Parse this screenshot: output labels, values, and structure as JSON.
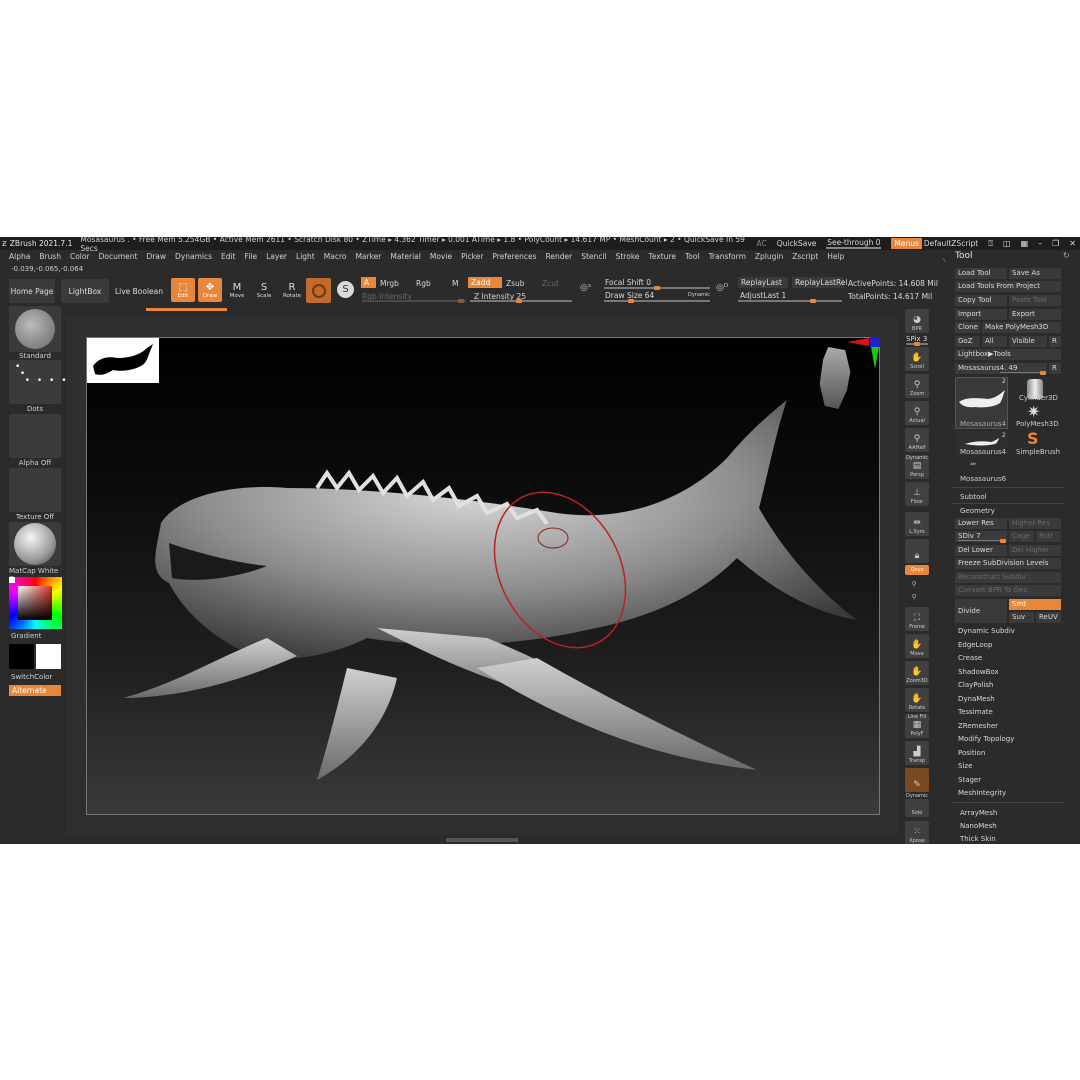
{
  "titlebar": {
    "app": "ZBrush 2021.7.1",
    "status": "Mosasaurus  . • Free Mem 5.254GB • Active Mem 2611 • Scratch Disk 80 •  ZTime ▸ 4.362 Timer ▸ 0.001 ATime ▸ 1.8 • PolyCount ▸ 14.617 MP  • MeshCount ▸ 2  • QuickSave In 59 Secs",
    "ac": "AC",
    "quicksave": "QuickSave",
    "seethrough": "See-through  0",
    "menus": "Menus",
    "script": "DefaultZScript"
  },
  "menubar": [
    "Alpha",
    "Brush",
    "Color",
    "Document",
    "Draw",
    "Dynamics",
    "Edit",
    "File",
    "Layer",
    "Light",
    "Macro",
    "Marker",
    "Material",
    "Movie",
    "Picker",
    "Preferences",
    "Render",
    "Stencil",
    "Stroke",
    "Texture",
    "Tool",
    "Transform",
    "Zplugin",
    "Zscript",
    "Help"
  ],
  "coords": "-0.039,-0.065,-0.064",
  "shelf": {
    "home": "Home Page",
    "lightbox": "LightBox",
    "liveboolean": "Live Boolean",
    "edit": "Edit",
    "draw": "Draw",
    "move": "Move",
    "scale": "Scale",
    "rotate": "Rotate",
    "a": "A",
    "mrgb": "Mrgb",
    "rgb": "Rgb",
    "m": "M",
    "rgbintensity": "Rgb Intensity",
    "zadd": "Zadd",
    "zsub": "Zsub",
    "zcut": "Zcut",
    "zintensity": "Z Intensity 25",
    "focalshift": "Focal Shift 0",
    "drawsize": "Draw Size 64",
    "dynamic": "Dynamic",
    "replaylast": "ReplayLast",
    "replaylastrel": "ReplayLastRel",
    "adjustlast": "AdjustLast 1",
    "activepoints": "ActivePoints: 14.608 Mil",
    "totalpoints": "TotalPoints: 14.617 Mil"
  },
  "lefttray": {
    "standard": "Standard",
    "dots": "Dots",
    "alpha": "Alpha Off",
    "texture": "Texture Off",
    "matcap": "MatCap White C",
    "gradient": "Gradient",
    "switchcolor": "SwitchColor",
    "alternate": "Alternate"
  },
  "righttray": {
    "bpr": "BPR",
    "spix": "SPix 3",
    "scroll": "Scroll",
    "zoom": "Zoom",
    "actual": "Actual",
    "aahalf": "AAHalf",
    "dynamic": "Dynamic",
    "persp": "Persp",
    "floor": "Floor",
    "lsym": "L.Sym",
    "xyz": "Qxyz",
    "frame": "Frame",
    "move": "Move",
    "zoom3d": "Zoom3D",
    "rotate": "Rotate",
    "linefill": "Line Fill",
    "polyf": "PolyF",
    "transp": "Transp",
    "dynamic2": "Dynamic",
    "solo": "Solo",
    "xpose": "Xpose"
  },
  "tool": {
    "title": "Tool",
    "loadtool": "Load Tool",
    "saveas": "Save As",
    "loadfromproject": "Load Tools From Project",
    "copytool": "Copy Tool",
    "pastetool": "Paste Tool",
    "import": "Import",
    "export": "Export",
    "clone": "Clone",
    "makepolymesh": "Make PolyMesh3D",
    "goz": "GoZ",
    "all": "All",
    "visible": "Visible",
    "r": "R",
    "lightboxtools": "Lightbox▶Tools",
    "current": "Mosasaurus4. 49",
    "r2": "R",
    "thumbs": [
      "Mosasaurus4",
      "Cylinder3D",
      "PolyMesh3D",
      "Mosasaurus4",
      "SimpleBrush",
      "Mosasaurus6"
    ],
    "badge1": "2",
    "badge2": "2",
    "subtool": "Subtool",
    "geometry": "Geometry",
    "lowerres": "Lower Res",
    "higherres": "Higher Res",
    "sdiv": "SDiv 7",
    "cage": "Cage",
    "rstr": "Rstr",
    "dellower": "Del Lower",
    "delhigher": "Del Higher",
    "freeze": "Freeze SubDivision Levels",
    "reconstruct": "Reconstruct Subdiv",
    "convertbpr": "Convert BPR To Geo",
    "divide": "Divide",
    "smt": "Smt",
    "suv": "Suv",
    "reuv": "ReUV",
    "items": [
      "Dynamic Subdiv",
      "EdgeLoop",
      "Crease",
      "ShadowBox",
      "ClayPolish",
      "DynaMesh",
      "Tessimate",
      "ZRemesher",
      "Modify Topology",
      "Position",
      "Size",
      "Stager",
      "MeshIntegrity"
    ],
    "bottom": [
      "ArrayMesh",
      "NanoMesh",
      "Thick Skin"
    ]
  },
  "colors": {
    "accent": "#e8873a",
    "panel": "#2b2b2b",
    "button": "#3a3a3a"
  }
}
